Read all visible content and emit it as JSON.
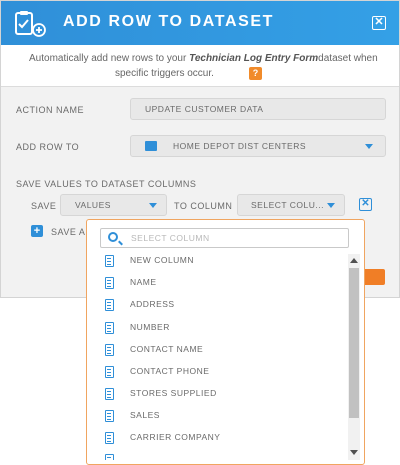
{
  "header": {
    "title": "ADD ROW TO DATASET",
    "close_glyph": "✕",
    "icon": "clipboard-add-icon"
  },
  "description": {
    "prefix": "Automatically add new rows to your ",
    "dataset_name": "Technician Log Entry Form",
    "suffix": "dataset when",
    "line2": "specific triggers occur.",
    "help_glyph": "?"
  },
  "form": {
    "action_name_label": "ACTION NAME",
    "action_name_value": "UPDATE CUSTOMER DATA",
    "add_row_to_label": "ADD ROW TO",
    "add_row_to_value": "HOME DEPOT DIST CENTERS",
    "save_values_heading": "SAVE VALUES TO DATASET COLUMNS",
    "save_label": "SAVE",
    "values_select": "VALUES",
    "to_column_label": "TO COLUMN",
    "column_select": "SELECT COLU...",
    "remove_glyph": "✕",
    "add_glyph": "+",
    "save_another_label": "SAVE AN"
  },
  "dropdown": {
    "search_placeholder": "SELECT COLUMN",
    "items": [
      "NEW COLUMN",
      "NAME",
      "ADDRESS",
      "NUMBER",
      "CONTACT NAME",
      "CONTACT PHONE",
      "STORES SUPPLIED",
      "SALES",
      "CARRIER COMPANY"
    ]
  },
  "colors": {
    "accent": "#2f8fd8",
    "orange": "#f07e26"
  }
}
